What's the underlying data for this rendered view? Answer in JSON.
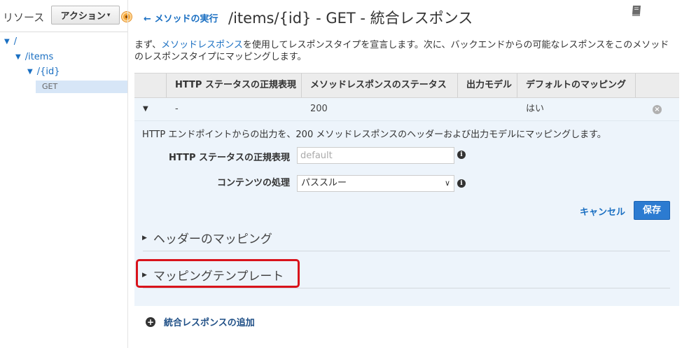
{
  "sidebar": {
    "resources_label": "リソース",
    "action_button": "アクション",
    "tree": [
      {
        "label": "/"
      },
      {
        "label": "/items"
      },
      {
        "label": "/{id}"
      },
      {
        "label": "GET"
      }
    ]
  },
  "header": {
    "back_link": "メソッドの実行",
    "title": "/items/{id} - GET - 統合レスポンス"
  },
  "description": {
    "before": "まず、",
    "link": "メソッドレスポンス",
    "after": "を使用してレスポンスタイプを宣言します。次に、バックエンドからの可能なレスポンスをこのメソッドのレスポンスタイプにマッピングします。"
  },
  "table": {
    "headers": [
      "HTTP ステータスの正規表現",
      "メソッドレスポンスのステータス",
      "出力モデル",
      "デフォルトのマッピング"
    ],
    "rows": [
      {
        "regex": "-",
        "status": "200",
        "model": "",
        "default": "はい"
      }
    ]
  },
  "detail": {
    "description": "HTTP エンドポイントからの出力を、200 メソッドレスポンスのヘッダーおよび出力モデルにマッピングします。",
    "regex_label": "HTTP ステータスの正規表現",
    "regex_placeholder": "default",
    "content_label": "コンテンツの処理",
    "content_value": "パススルー",
    "cancel": "キャンセル",
    "save": "保存",
    "header_mapping": "ヘッダーのマッピング",
    "mapping_templates": "マッピングテンプレート"
  },
  "add_response": "統合レスポンスの追加",
  "colors": {
    "link": "#1a6fc2",
    "save_button": "#2c7bd1",
    "highlight": "#d9131b",
    "panel": "#edf4fb"
  }
}
